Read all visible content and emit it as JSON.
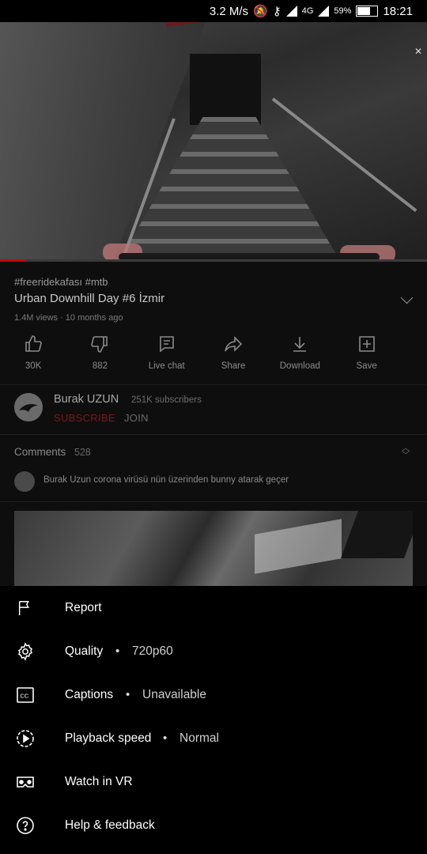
{
  "status_bar": {
    "net_speed": "3.2 M/s",
    "network_type": "4G",
    "battery": "59%",
    "time": "18:21"
  },
  "player": {
    "progress": 0.06,
    "accent_color": "#cc0000"
  },
  "video": {
    "hashtags": "#freeridekafası #mtb",
    "title": "Urban Downhill Day #6 İzmir",
    "meta": "1.4M views · 10 months ago"
  },
  "actions": [
    {
      "icon": "thumbs-up-icon",
      "label": "30K"
    },
    {
      "icon": "thumbs-down-icon",
      "label": "882"
    },
    {
      "icon": "live-chat-icon",
      "label": "Live chat"
    },
    {
      "icon": "share-icon",
      "label": "Share"
    },
    {
      "icon": "download-icon",
      "label": "Download"
    },
    {
      "icon": "save-icon",
      "label": "Save"
    }
  ],
  "channel": {
    "name": "Burak UZUN",
    "subscribers": "251K subscribers",
    "subscribe_label": "SUBSCRIBE",
    "join_label": "JOIN"
  },
  "comments": {
    "label": "Comments",
    "count": "528",
    "top_comment": "Burak Uzun corona virüsü nün üzerinden bunny atarak geçer"
  },
  "menu": {
    "report": "Report",
    "quality_label": "Quality",
    "quality_value": "720p60",
    "captions_label": "Captions",
    "captions_value": "Unavailable",
    "speed_label": "Playback speed",
    "speed_value": "Normal",
    "vr_label": "Watch in VR",
    "help_label": "Help & feedback",
    "separator": "•"
  }
}
